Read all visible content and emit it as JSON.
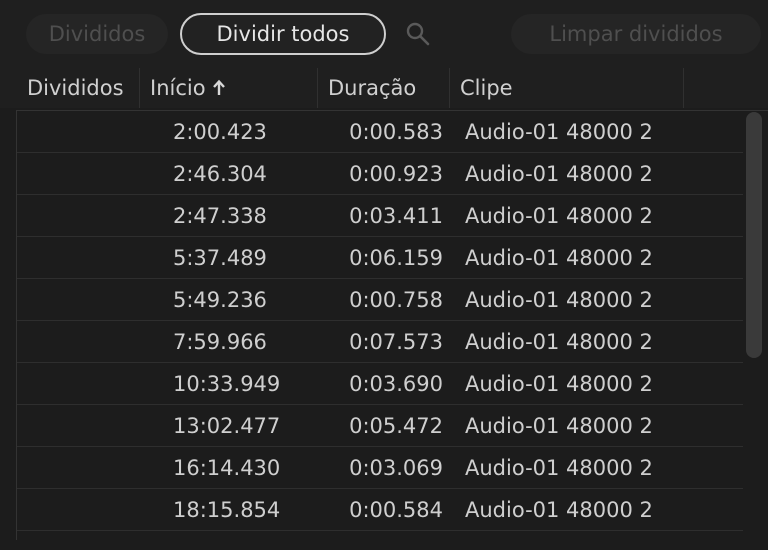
{
  "toolbar": {
    "divided_label": "Divididos",
    "split_all_label": "Dividir todos",
    "clear_label": "Limpar divididos"
  },
  "columns": {
    "divided": "Divididos",
    "start": "Início",
    "duration": "Duração",
    "clip": "Clipe"
  },
  "rows": [
    {
      "start": "2:00.423",
      "duration": "0:00.583",
      "clip": "Audio-01 48000 2"
    },
    {
      "start": "2:46.304",
      "duration": "0:00.923",
      "clip": "Audio-01 48000 2"
    },
    {
      "start": "2:47.338",
      "duration": "0:03.411",
      "clip": "Audio-01 48000 2"
    },
    {
      "start": "5:37.489",
      "duration": "0:06.159",
      "clip": "Audio-01 48000 2"
    },
    {
      "start": "5:49.236",
      "duration": "0:00.758",
      "clip": "Audio-01 48000 2"
    },
    {
      "start": "7:59.966",
      "duration": "0:07.573",
      "clip": "Audio-01 48000 2"
    },
    {
      "start": "10:33.949",
      "duration": "0:03.690",
      "clip": "Audio-01 48000 2"
    },
    {
      "start": "13:02.477",
      "duration": "0:05.472",
      "clip": "Audio-01 48000 2"
    },
    {
      "start": "16:14.430",
      "duration": "0:03.069",
      "clip": "Audio-01 48000 2"
    },
    {
      "start": "18:15.854",
      "duration": "0:00.584",
      "clip": "Audio-01 48000 2"
    }
  ]
}
